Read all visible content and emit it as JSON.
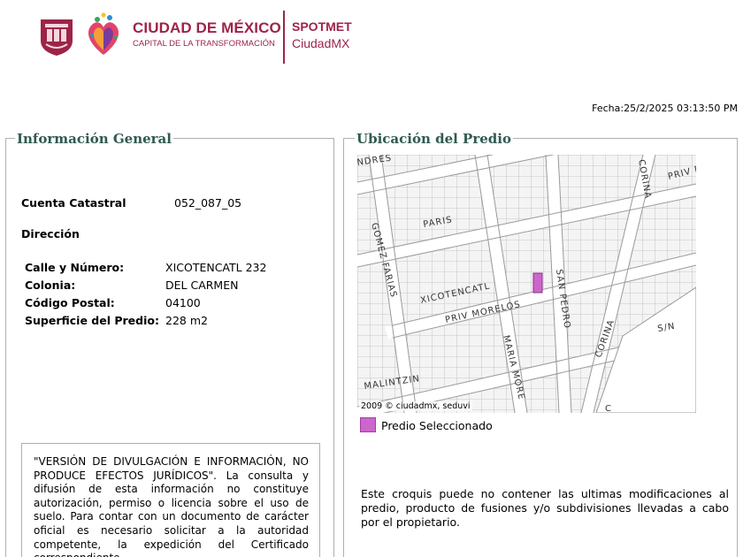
{
  "header": {
    "brand_main": "CIUDAD DE MÉXICO",
    "brand_sub": "CAPITAL DE LA TRANSFORMACIÓN",
    "app_line1": "SPOTMET",
    "app_line2": "CiudadMX",
    "fecha": "Fecha:25/2/2025 03:13:50 PM",
    "brand_color": "#9d2449"
  },
  "info_general": {
    "title": "Información General",
    "cuenta_label": "Cuenta Catastral",
    "cuenta_value": "052_087_05",
    "direccion_label": "Dirección",
    "fields": [
      {
        "label": "Calle y Número:",
        "value": "XICOTENCATL 232"
      },
      {
        "label": "Colonia:",
        "value": "DEL CARMEN"
      },
      {
        "label": "Código Postal:",
        "value": "04100"
      },
      {
        "label": "Superficie del Predio:",
        "value": "228 m2"
      }
    ],
    "disclaimer": "\"VERSIÓN DE DIVULGACIÓN E INFORMACIÓN, NO PRODUCE EFECTOS JURÍDICOS\". La consulta y difusión de esta información no constituye autorización, permiso o licencia sobre el uso de suelo. Para contar con un documento de carácter oficial es necesario solicitar a la autoridad competente, la expedición del Certificado correspondiente."
  },
  "ubicacion": {
    "title": "Ubicación del Predio",
    "map_copyright": "2009 © ciudadmx, seduvi",
    "map_streets": [
      "NDRES",
      "CORINA",
      "PRIV PARI",
      "PARIS",
      "GOMEZ FARIAS",
      "XICOTENCATL",
      "SAN PEDRO",
      "PRIV MORELOS",
      "MARIA MORE",
      "S/N",
      "CORINA",
      "MALINTZIN",
      "C"
    ],
    "legend_label": "Predio Seleccionado",
    "legend_color": "#cc66cc",
    "note": "Este croquis puede no contener las ultimas modificaciones al predio, producto de fusiones y/o subdivisiones llevadas a cabo por el propietario."
  }
}
